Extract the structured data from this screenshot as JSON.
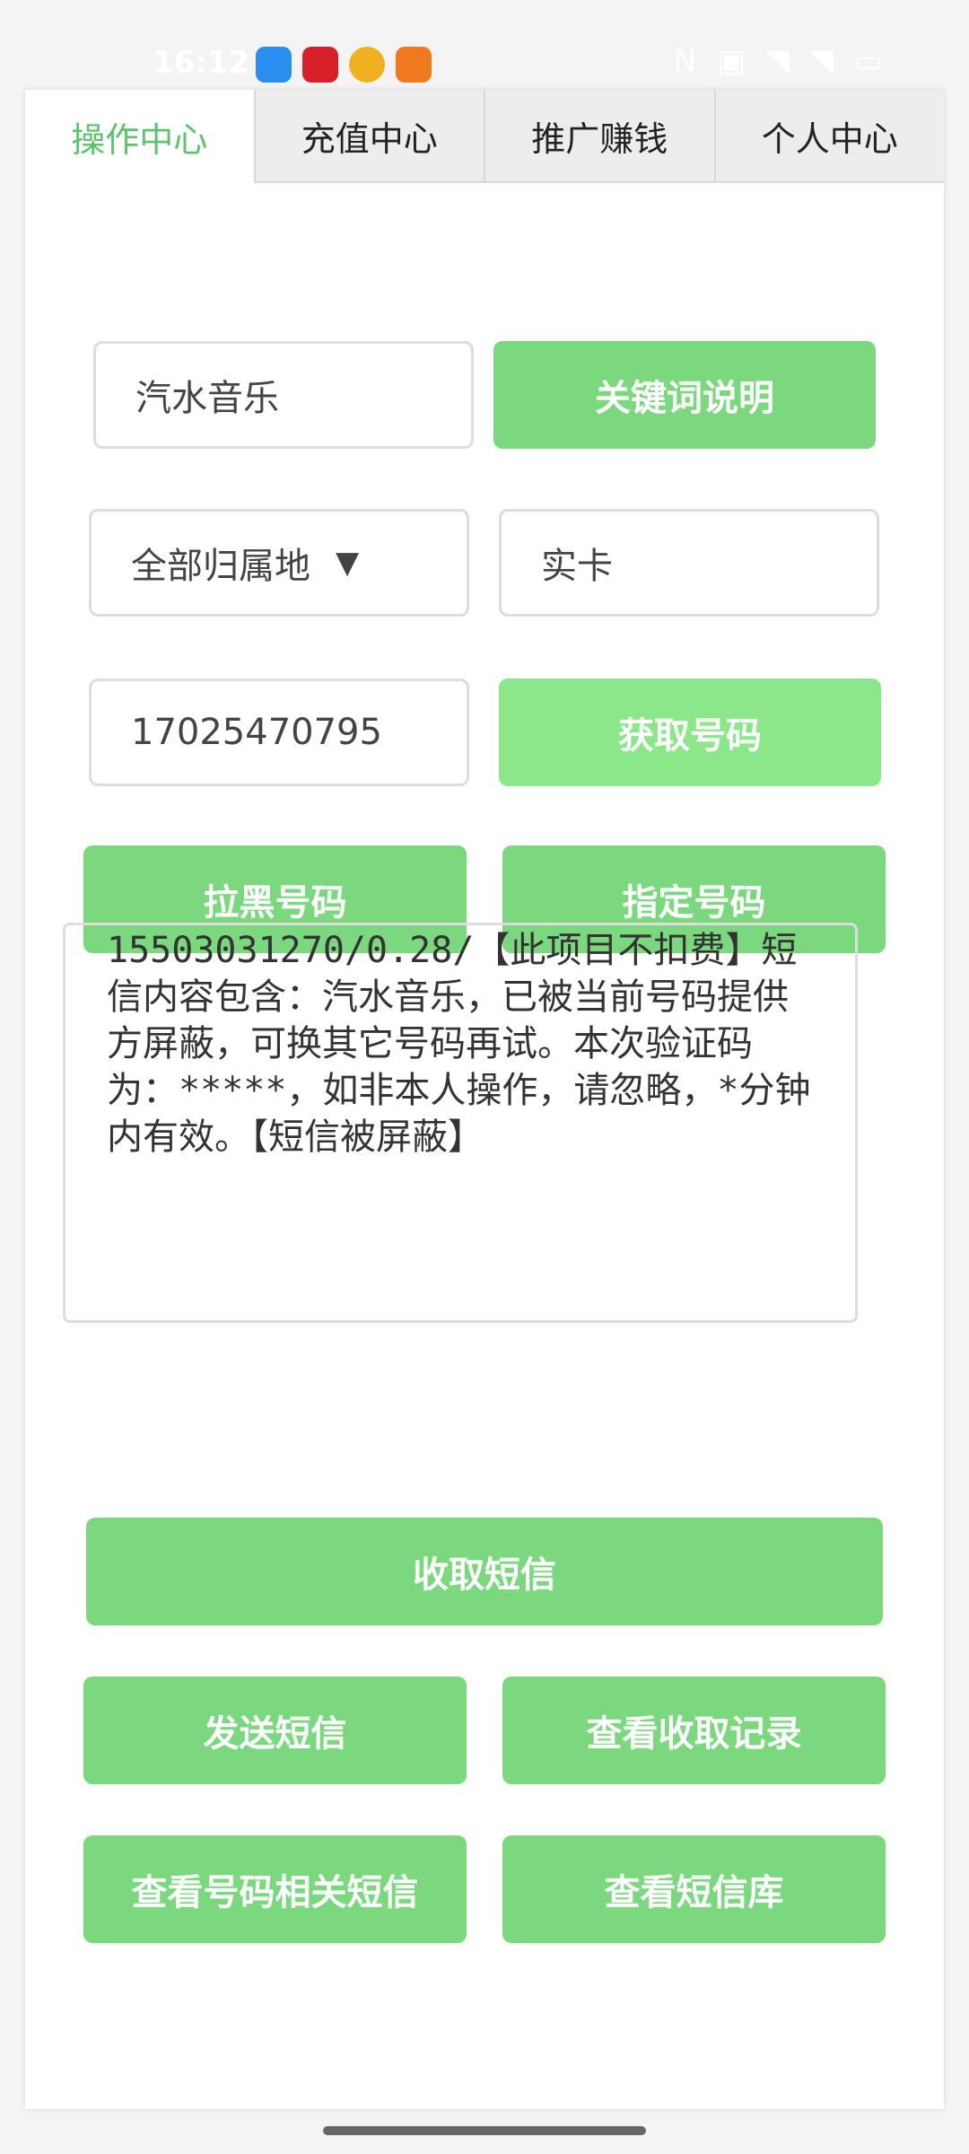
{
  "status_bar": {
    "time": "16:12",
    "right_icons": "N ▣ ◥ ◥ ▭",
    "app_icons": [
      "qq-icon",
      "news-icon",
      "weibo-icon",
      "redpacket-icon"
    ],
    "app_icon_colors": [
      "#2a8ef0",
      "#d8202a",
      "#f0b020",
      "#f07a20"
    ]
  },
  "tabs": [
    {
      "label": "操作中心",
      "active": true
    },
    {
      "label": "充值中心",
      "active": false
    },
    {
      "label": "推广赚钱",
      "active": false
    },
    {
      "label": "个人中心",
      "active": false
    }
  ],
  "form": {
    "keyword_value": "汽水音乐",
    "keyword_help_label": "关键词说明",
    "region_value": "全部归属地",
    "card_type_value": "实卡",
    "phone_value": "17025470795",
    "get_number_label": "获取号码"
  },
  "actions": {
    "blacklist_label": "拉黑号码",
    "specify_label": "指定号码",
    "receive_sms_label": "收取短信",
    "send_sms_label": "发送短信",
    "view_records_label": "查看收取记录",
    "view_related_label": "查看号码相关短信",
    "view_library_label": "查看短信库"
  },
  "message_box": {
    "content": "15503031270/0.28/【此项目不扣费】短信内容包含：汽水音乐，已被当前号码提供方屏蔽，可换其它号码再试。本次验证码为：*****，如非本人操作，请忽略，*分钟内有效。【短信被屏蔽】"
  },
  "colors": {
    "accent_green": "#7cd87e",
    "accent_green_light": "#8ce68a",
    "active_tab_text": "#5cc36f"
  }
}
